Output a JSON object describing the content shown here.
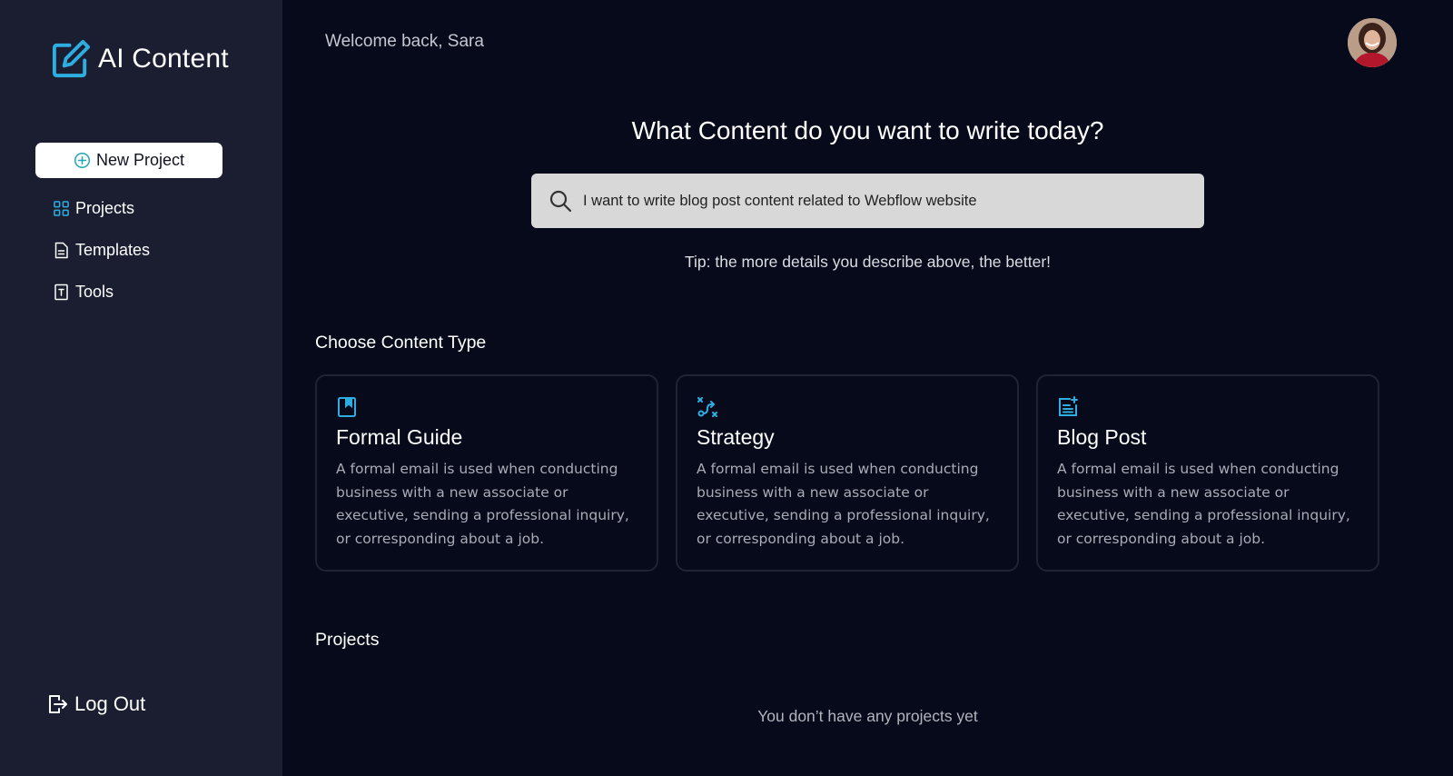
{
  "app": {
    "name": "AI Content"
  },
  "sidebar": {
    "new_project_label": "New Project",
    "items": [
      {
        "label": "Projects",
        "icon": "grid-icon"
      },
      {
        "label": "Templates",
        "icon": "document-icon"
      },
      {
        "label": "Tools",
        "icon": "text-tool-icon"
      }
    ],
    "logout_label": "Log Out"
  },
  "header": {
    "welcome": "Welcome back, Sara"
  },
  "main": {
    "headline": "What Content do you want to write today?",
    "search": {
      "value": "I want to write blog post content related to Webflow website"
    },
    "tip": "Tip: the more details you describe above, the better!",
    "content_type_title": "Choose Content Type",
    "content_types": [
      {
        "title": "Formal Guide",
        "icon": "bookmark-icon",
        "description": "A formal email is used when conducting business with a new associate or executive, sending a professional inquiry, or corresponding about a job."
      },
      {
        "title": "Strategy",
        "icon": "route-icon",
        "description": "A formal email is used when conducting business with a new associate or executive, sending a professional inquiry, or corresponding about a job."
      },
      {
        "title": "Blog Post",
        "icon": "note-add-icon",
        "description": "A formal email is used when conducting business with a new associate or executive, sending a professional inquiry, or corresponding about a job."
      }
    ],
    "projects_title": "Projects",
    "projects_empty": "You don’t have any projects yet"
  },
  "colors": {
    "accent": "#2eaee0",
    "sidebar_bg": "#1b1e30",
    "page_bg": "#070a1b"
  }
}
